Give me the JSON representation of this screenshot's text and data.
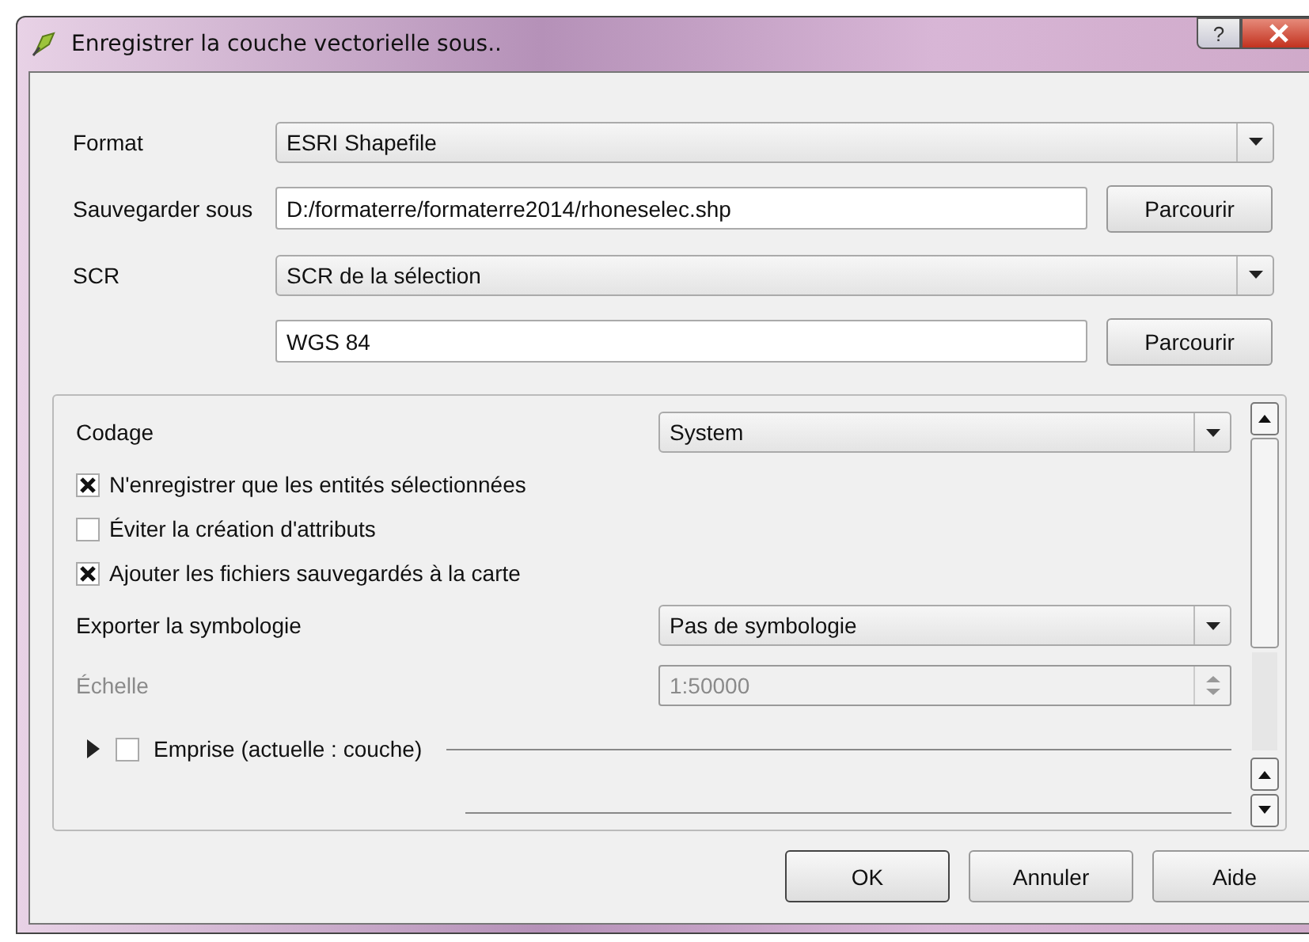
{
  "window": {
    "title": "Enregistrer la couche vectorielle sous..",
    "help_button": "?"
  },
  "form": [
    {
      "kind": "combo",
      "label": "Format",
      "value": "ESRI Shapefile"
    },
    {
      "kind": "field",
      "label": "Sauvegarder sous",
      "value": "D:/formaterre/formaterre2014/rhoneselec.shp",
      "button": "Parcourir"
    },
    {
      "kind": "combo",
      "label": "SCR",
      "value": "SCR de la sélection"
    },
    {
      "kind": "field",
      "value": "WGS 84",
      "button": "Parcourir"
    }
  ],
  "options": [
    {
      "kind": "combo",
      "label": "Codage",
      "value": "System"
    },
    {
      "kind": "checkbox",
      "label": "N'enregistrer que les entités sélectionnées",
      "checked": true
    },
    {
      "kind": "checkbox",
      "label": "Éviter la création d'attributs",
      "checked": false
    },
    {
      "kind": "checkbox",
      "label": "Ajouter les fichiers sauvegardés à la carte",
      "checked": true
    },
    {
      "kind": "combo",
      "label": "Exporter la symbologie",
      "value": "Pas de symbologie"
    },
    {
      "kind": "spin",
      "label": "Échelle",
      "value": "1:50000",
      "disabled": true
    },
    {
      "kind": "group",
      "label": "Emprise (actuelle : couche)",
      "checked": false,
      "expanded": false
    }
  ],
  "buttons": [
    {
      "label": "OK",
      "default": true
    },
    {
      "label": "Annuler",
      "default": false
    },
    {
      "label": "Aide",
      "default": false
    }
  ]
}
